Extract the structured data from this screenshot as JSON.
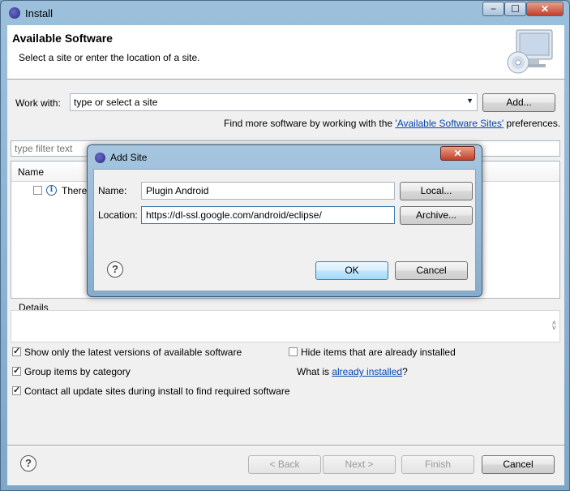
{
  "window": {
    "title": "Install",
    "min_label": "−",
    "max_label": "☐",
    "close_label": "✕"
  },
  "header": {
    "title": "Available Software",
    "subtitle": "Select a site or enter the location of a site."
  },
  "work_with": {
    "label": "Work with:",
    "value": "type or select a site",
    "add_label": "Add...",
    "find_more_prefix": "Find more software by working with the ",
    "find_more_link": "'Available Software Sites'",
    "find_more_suffix": " preferences."
  },
  "filter": {
    "placeholder": "type filter text"
  },
  "tree": {
    "column_name": "Name",
    "row_text": "There"
  },
  "details": {
    "label": "Details"
  },
  "options": {
    "show_latest": "Show only the latest versions of available software",
    "group_by_category": "Group items by category",
    "contact_sites": "Contact all update sites during install to find required software",
    "hide_installed": "Hide items that are already installed",
    "what_is_prefix": "What is ",
    "what_is_link": "already installed",
    "what_is_suffix": "?"
  },
  "footer": {
    "back_label": "< Back",
    "next_label": "Next >",
    "finish_label": "Finish",
    "cancel_label": "Cancel"
  },
  "add_site_dialog": {
    "title": "Add Site",
    "close_label": "✕",
    "name_label": "Name:",
    "name_value": "Plugin Android",
    "local_label": "Local...",
    "location_label": "Location:",
    "location_value": "https://dl-ssl.google.com/android/eclipse/",
    "archive_label": "Archive...",
    "ok_label": "OK",
    "cancel_label": "Cancel"
  },
  "colors": {
    "link": "#0645ad",
    "titlebar": "#9cc0dc",
    "default_button": "#a7d9f5"
  }
}
